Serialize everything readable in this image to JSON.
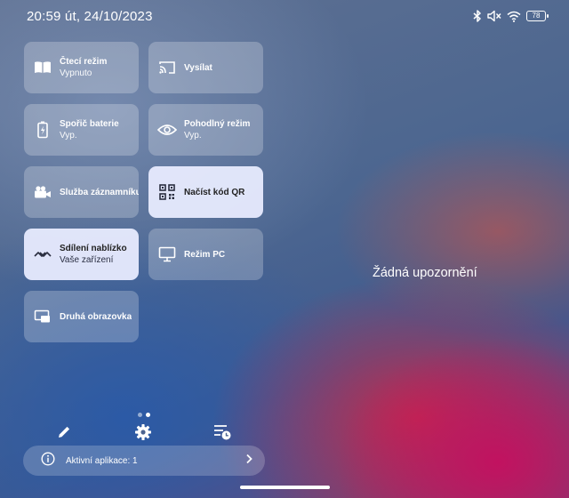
{
  "status_bar": {
    "time": "20:59 út, 24/10/2023",
    "battery": "78",
    "icons": [
      "bluetooth-icon",
      "mute-icon",
      "wifi-icon",
      "battery-icon"
    ]
  },
  "tiles": [
    {
      "title": "Čtecí režim",
      "subtitle": "Vypnuto",
      "icon": "book-icon",
      "active": false
    },
    {
      "title": "Vysílat",
      "subtitle": "",
      "icon": "cast-icon",
      "active": false
    },
    {
      "title": "Spořič baterie",
      "subtitle": "Vyp.",
      "icon": "battery-saver-icon",
      "active": false
    },
    {
      "title": "Pohodlný režim",
      "subtitle": "Vyp.",
      "icon": "eye-icon",
      "active": false
    },
    {
      "title": "Služba záznamníku",
      "subtitle": "",
      "icon": "video-camera-icon",
      "active": false
    },
    {
      "title": "Načíst kód QR",
      "subtitle": "",
      "icon": "qr-code-icon",
      "active": true
    },
    {
      "title": "Sdílení nablízko",
      "subtitle": "Vaše zařízení",
      "icon": "nearby-share-icon",
      "active": true
    },
    {
      "title": "Režim PC",
      "subtitle": "",
      "icon": "monitor-icon",
      "active": false
    },
    {
      "title": "Druhá obrazovka",
      "subtitle": "",
      "icon": "second-screen-icon",
      "active": false
    }
  ],
  "page_indicator": {
    "pages": 2,
    "current": 2
  },
  "bottom_actions": [
    "edit-icon",
    "settings-icon",
    "schedule-list-icon"
  ],
  "active_apps": {
    "label": "Aktivní aplikace: 1"
  },
  "notifications": {
    "empty_text": "Žádná upozornění"
  }
}
